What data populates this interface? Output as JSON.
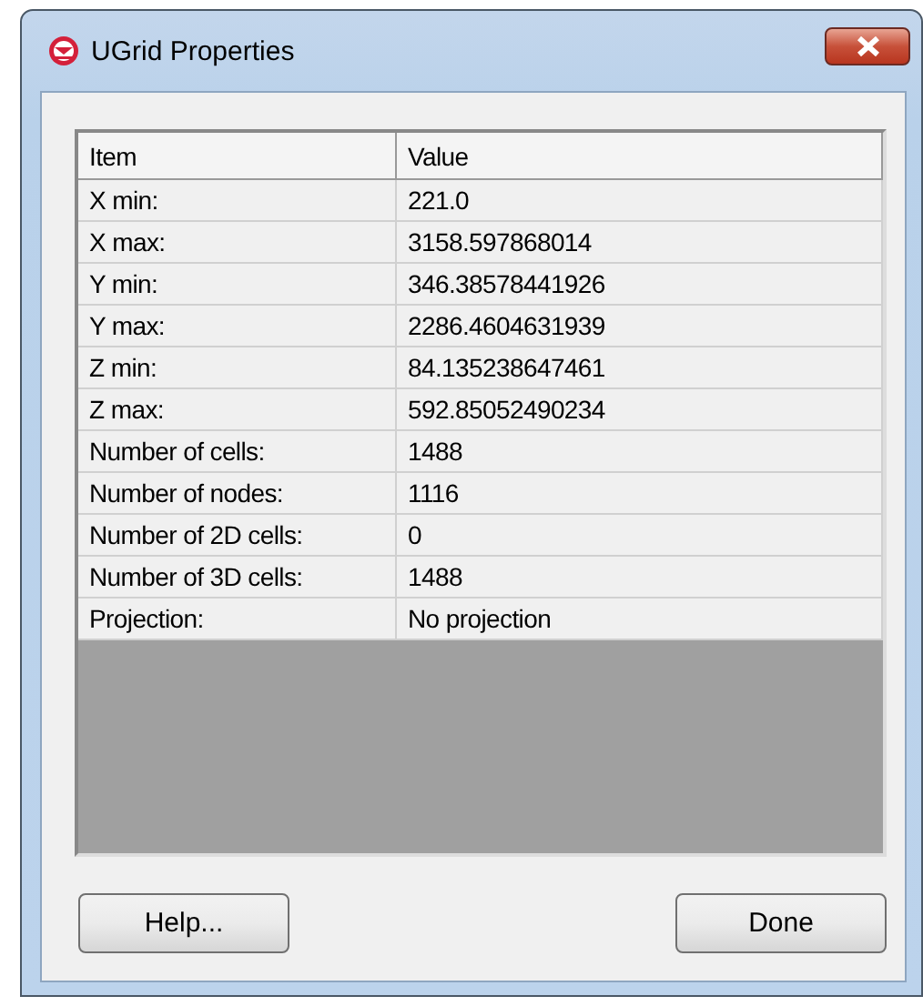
{
  "window": {
    "title": "UGrid Properties"
  },
  "table": {
    "columns": [
      "Item",
      "Value"
    ],
    "rows": [
      [
        "X min:",
        "221.0"
      ],
      [
        "X max:",
        "3158.597868014"
      ],
      [
        "Y min:",
        "346.38578441926"
      ],
      [
        "Y max:",
        "2286.4604631939"
      ],
      [
        "Z min:",
        "84.135238647461"
      ],
      [
        "Z max:",
        "592.85052490234"
      ],
      [
        "Number of cells:",
        "1488"
      ],
      [
        "Number of nodes:",
        "1116"
      ],
      [
        "Number of 2D cells:",
        "0"
      ],
      [
        "Number of 3D cells:",
        "1488"
      ],
      [
        "Projection:",
        "No projection"
      ]
    ]
  },
  "buttons": [
    "Help...",
    "Done"
  ]
}
